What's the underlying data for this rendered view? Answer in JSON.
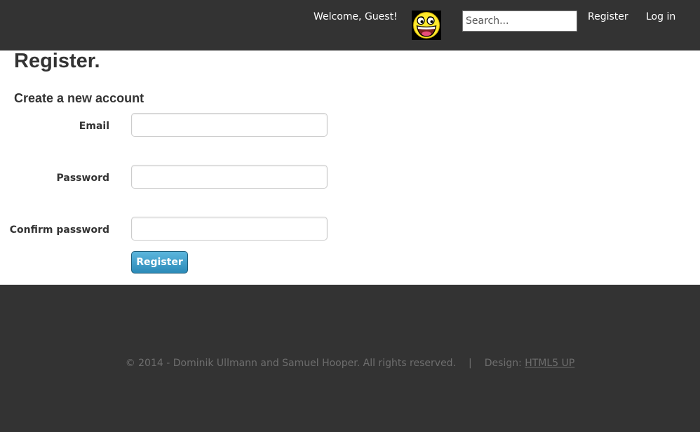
{
  "header": {
    "welcome": "Welcome, Guest!",
    "avatar_icon": "awesome-smiley-face-icon",
    "search_placeholder": "Search...",
    "nav": {
      "register": "Register",
      "login": "Log in"
    }
  },
  "main": {
    "title": "Register.",
    "subtitle": "Create a new account",
    "fields": {
      "email": {
        "label": "Email",
        "value": ""
      },
      "password": {
        "label": "Password",
        "value": ""
      },
      "confirm": {
        "label": "Confirm password",
        "value": ""
      }
    },
    "submit_label": "Register"
  },
  "footer": {
    "copyright": "© 2014 - Dominik Ullmann and Samuel Hooper. All rights reserved.",
    "separator": "|",
    "design_prefix": "Design:",
    "design_link": "HTML5 UP"
  },
  "colors": {
    "background_dark": "#333333",
    "content_background": "#ffffff",
    "button_blue": "#3a9bc9",
    "footer_text": "#6e6e6e"
  }
}
